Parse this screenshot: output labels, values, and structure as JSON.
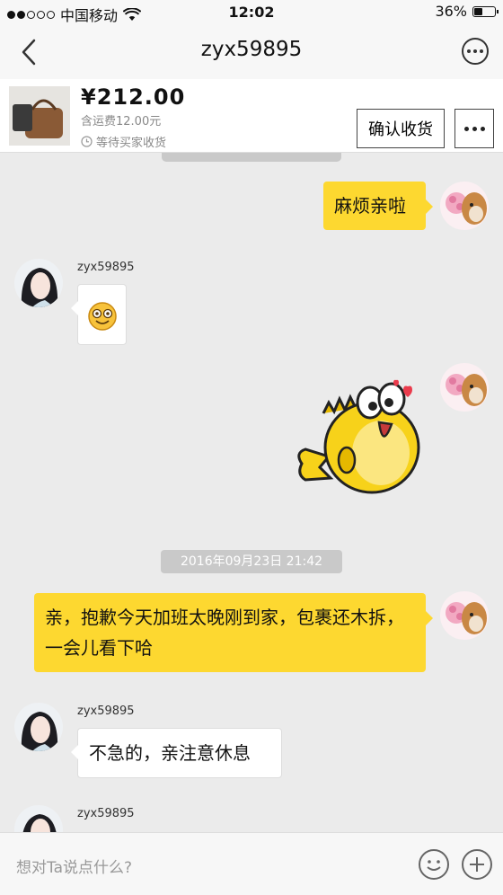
{
  "status_bar": {
    "carrier": "中国移动",
    "time": "12:02",
    "battery": "36%"
  },
  "nav": {
    "title": "zyx59895"
  },
  "order": {
    "price": "¥212.00",
    "shipping": "含运费12.00元",
    "status": "等待买家收货",
    "confirm_label": "确认收货"
  },
  "messages": {
    "m1": "麻烦亲啦",
    "sender1": "zyx59895",
    "timestamp": "2016年09月23日 21:42",
    "m4": "亲，抱歉今天加班太晚刚到家，包裹还木拆，一会儿看下哈",
    "sender2": "zyx59895",
    "m5": "不急的，亲注意休息",
    "sender3": "zyx59895"
  },
  "input": {
    "placeholder": "想对Ta说点什么?"
  },
  "colors": {
    "my_bubble": "#fdd830",
    "background": "#ebebeb"
  },
  "icons": [
    "wifi-icon",
    "back-icon",
    "more-icon",
    "clock-icon",
    "smile-emoji-icon",
    "fish-sticker",
    "emoji-button-icon",
    "plus-icon"
  ]
}
